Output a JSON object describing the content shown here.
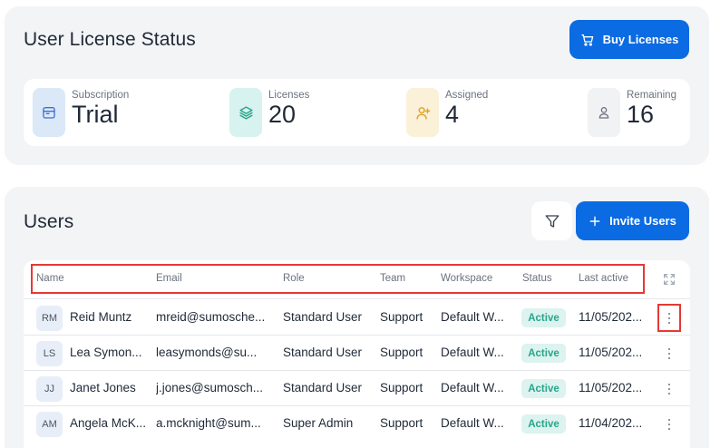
{
  "license": {
    "title": "User License Status",
    "buy_button_label": "Buy Licenses",
    "stats": [
      {
        "label": "Subscription",
        "value": "Trial",
        "icon": "calendar-icon",
        "color": "#dbe8f7"
      },
      {
        "label": "Licenses",
        "value": "20",
        "icon": "layers-icon",
        "color": "#d8f2ef"
      },
      {
        "label": "Assigned",
        "value": "4",
        "icon": "user-plus-icon",
        "color": "#fbf0d8"
      },
      {
        "label": "Remaining",
        "value": "16",
        "icon": "user-icon",
        "color": "#f1f2f4"
      }
    ]
  },
  "users": {
    "title": "Users",
    "invite_button_label": "Invite Users",
    "filter_icon": "filter-icon",
    "expand_icon": "expand-icon",
    "columns": [
      "Name",
      "Email",
      "Role",
      "Team",
      "Workspace",
      "Status",
      "Last active"
    ],
    "rows": [
      {
        "initials": "RM",
        "name": "Reid Muntz",
        "email": "mreid@sumosche...",
        "role": "Standard User",
        "team": "Support",
        "workspace": "Default W...",
        "status": "Active",
        "last_active": "11/05/202..."
      },
      {
        "initials": "LS",
        "name": "Lea Symon...",
        "email": "leasymonds@su...",
        "role": "Standard User",
        "team": "Support",
        "workspace": "Default W...",
        "status": "Active",
        "last_active": "11/05/202..."
      },
      {
        "initials": "JJ",
        "name": "Janet Jones",
        "email": "j.jones@sumosch...",
        "role": "Standard User",
        "team": "Support",
        "workspace": "Default W...",
        "status": "Active",
        "last_active": "11/05/202..."
      },
      {
        "initials": "AM",
        "name": "Angela McK...",
        "email": "a.mcknight@sum...",
        "role": "Super Admin",
        "team": "Support",
        "workspace": "Default W...",
        "status": "Active",
        "last_active": "11/04/202..."
      }
    ]
  },
  "colors": {
    "primary": "#0b6be3",
    "active_badge_bg": "#dcf3ef",
    "active_badge_text": "#2aa58c",
    "highlight": "#e53935"
  }
}
